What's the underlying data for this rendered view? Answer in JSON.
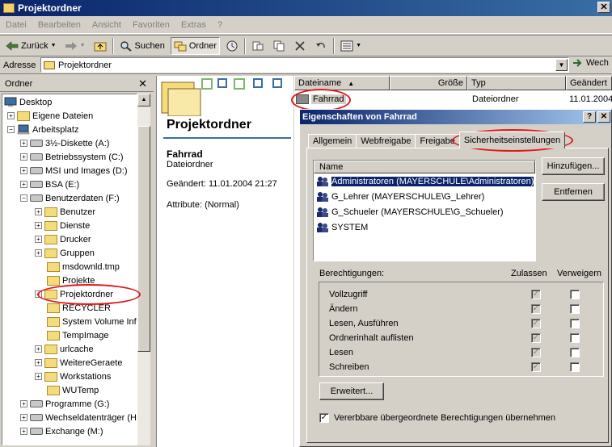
{
  "window": {
    "title": "Projektordner"
  },
  "menu": [
    "Datei",
    "Bearbeiten",
    "Ansicht",
    "Favoriten",
    "Extras",
    "?"
  ],
  "toolbar": {
    "back": "Zurück",
    "search": "Suchen",
    "folders": "Ordner"
  },
  "address": {
    "label": "Adresse",
    "value": "Projektordner",
    "go": "Wech"
  },
  "folder_pane": {
    "title": "Ordner",
    "items": [
      "Desktop",
      "Eigene Dateien",
      "Arbeitsplatz",
      "3½-Diskette (A:)",
      "Betriebssystem (C:)",
      "MSI und Images (D:)",
      "BSA (E:)",
      "Benutzerdaten (F:)",
      "Benutzer",
      "Dienste",
      "Drucker",
      "Gruppen",
      "msdownld.tmp",
      "Projekte",
      "Projektordner",
      "RECYCLER",
      "System Volume Info",
      "TempImage",
      "urlcache",
      "WeitereGeraete",
      "Workstations",
      "WUTemp",
      "Programme (G:)",
      "Wechseldatenträger (H",
      "Exchange (M:)"
    ]
  },
  "web_view": {
    "title": "Projektordner",
    "name": "Fahrrad",
    "type": "Dateiordner",
    "changed": "Geändert: 11.01.2004 21:27",
    "attributes": "Attribute: (Normal)"
  },
  "file_list": {
    "columns": [
      "Dateiname",
      "Größe",
      "Typ",
      "Geändert"
    ],
    "rows": [
      {
        "name": "Fahrrad",
        "type": "Dateiordner",
        "changed": "11.01.2004"
      }
    ]
  },
  "dialog": {
    "title": "Eigenschaften von Fahrrad",
    "tabs": [
      "Allgemein",
      "Webfreigabe",
      "Freigabe",
      "Sicherheitseinstellungen"
    ],
    "name_header": "Name",
    "principals": [
      "Administratoren (MAYERSCHULE\\Administratoren)",
      "G_Lehrer (MAYERSCHULE\\G_Lehrer)",
      "G_Schueler (MAYERSCHULE\\G_Schueler)",
      "SYSTEM"
    ],
    "add_button": "Hinzufügen...",
    "remove_button": "Entfernen",
    "permissions_label": "Berechtigungen:",
    "allow_label": "Zulassen",
    "deny_label": "Verweigern",
    "permissions": [
      "Vollzugriff",
      "Ändern",
      "Lesen, Ausführen",
      "Ordnerinhalt auflisten",
      "Lesen",
      "Schreiben"
    ],
    "advanced_button": "Erweitert...",
    "inherit_label": "Vererbbare übergeordnete Berechtigungen übernehmen"
  },
  "colors": {
    "titlebar": "#0a246a",
    "highlight_circle": "#e01818",
    "selection": "#0a246a"
  }
}
